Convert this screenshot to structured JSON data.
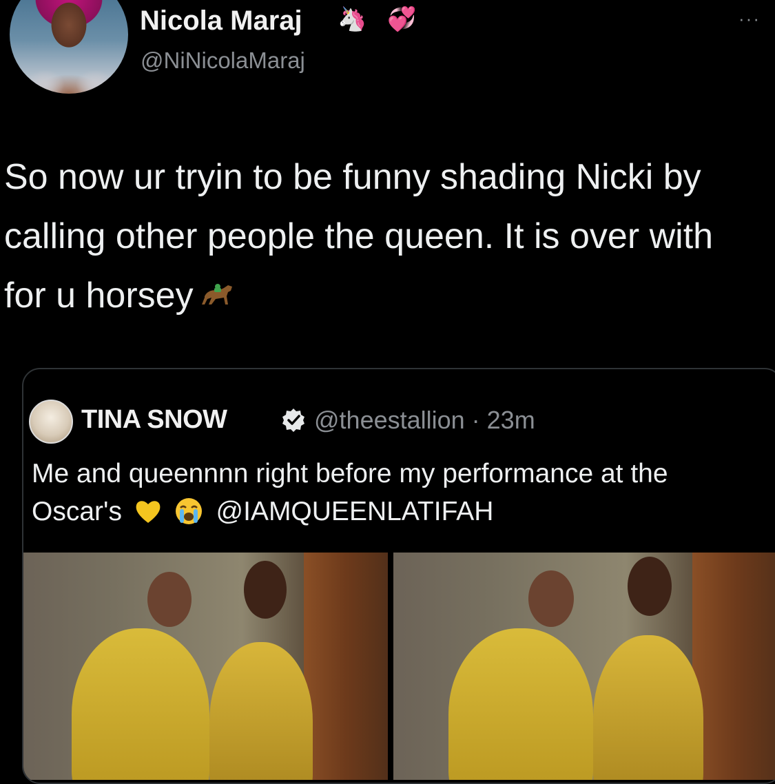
{
  "author": {
    "display_name": "Nicola Maraj",
    "name_emojis": [
      "🦄",
      "💞"
    ],
    "handle": "@NiNicolaMaraj",
    "more_icon": "···"
  },
  "tweet": {
    "text": "So now ur tryin to be funny shading Nicki by calling other people the queen. It is over with for u horsey",
    "emoji_icon": "horse-racing-icon"
  },
  "quoted": {
    "display_name": "TINA SNOW",
    "verified_icon": "verified-badge-icon",
    "handle_time": "@theestallion · 23m",
    "text_part1": "Me and queennnn right before my performance at the Oscar's",
    "emojis": [
      "💛",
      "😭"
    ],
    "mention": "@IAMQUEENLATIFAH",
    "photos": [
      {
        "label": "photo-left"
      },
      {
        "label": "photo-right"
      }
    ]
  },
  "colors": {
    "background": "#000000",
    "text": "#eef0f1",
    "muted": "#8b8f94",
    "border": "#2f3336",
    "gold": "#d4b43a"
  }
}
